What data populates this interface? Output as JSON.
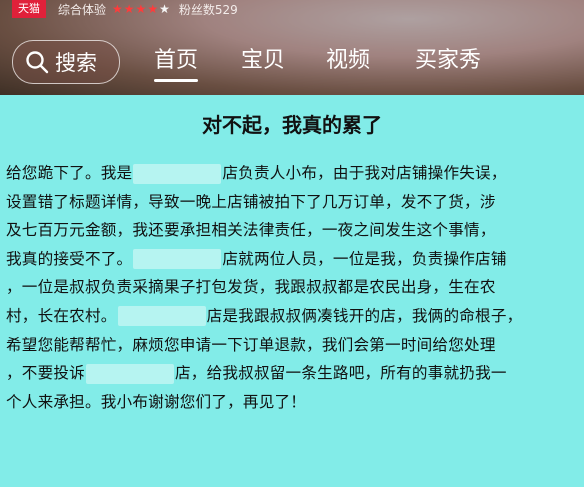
{
  "shop_header": {
    "badge": "天猫",
    "rating_label": "综合体验",
    "rating_stars": 4,
    "rating_max": 5,
    "fans_label": "粉丝数529"
  },
  "search": {
    "label": "搜索",
    "icon": "search-icon"
  },
  "nav": {
    "tabs": [
      {
        "label": "首页",
        "active": true
      },
      {
        "label": "宝贝",
        "active": false
      },
      {
        "label": "视频",
        "active": false
      },
      {
        "label": "买家秀",
        "active": false
      }
    ]
  },
  "notice": {
    "title": "对不起，我真的累了",
    "lines": [
      [
        "给您跪下了。我是",
        "店负责人小布，由于我对店铺操作失误，"
      ],
      [
        "设置错了标题详情，导致一晚上店铺被拍下了几万订单，发不了货，涉"
      ],
      [
        "及七百万元金额，我还要承担相关法律责任，一夜之间发生这个事情，"
      ],
      [
        "我真的接受不了。",
        "店就两位人员，一位是我，负责操作店铺"
      ],
      [
        "，一位是叔叔负责采摘果子打包发货，我跟叔叔都是农民出身，生在农"
      ],
      [
        "村，长在农村。",
        "店是我跟叔叔俩凑钱开的店，我俩的命根子，"
      ],
      [
        "希望您能帮帮忙，麻烦您申请一下订单退款，我们会第一时间给您处理"
      ],
      [
        "，不要投诉",
        "店，给我叔叔留一条生路吧，所有的事就扔我一"
      ],
      [
        "个人来承担。我小布谢谢您们了，再见了！"
      ]
    ]
  },
  "colors": {
    "panel_bg": "#82ece8",
    "tmall_red": "#e0213a",
    "star_red": "#ff3b3b"
  }
}
